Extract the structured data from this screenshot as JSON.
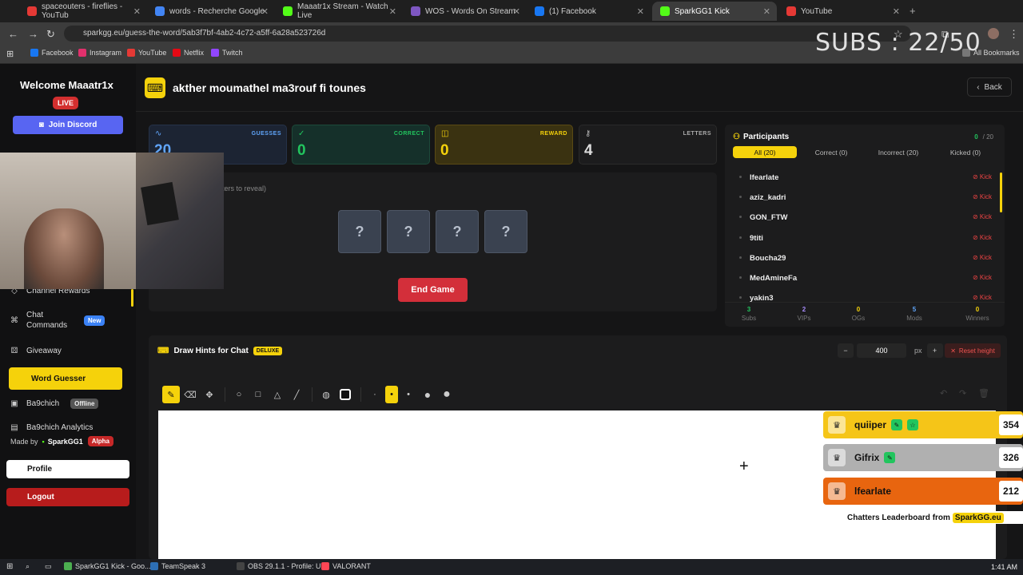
{
  "browser": {
    "tabs": [
      {
        "title": "spaceouters - fireflies - YouTub",
        "color": "#e53935"
      },
      {
        "title": "words - Recherche Google",
        "color": "#4285f4"
      },
      {
        "title": "Maaatr1x Stream - Watch Live",
        "color": "#53fc18"
      },
      {
        "title": "WOS - Words On Stream",
        "color": "#7e57c2"
      },
      {
        "title": "(1) Facebook",
        "color": "#1877f2"
      },
      {
        "title": "SparkGG1 Kick",
        "color": "#53fc18"
      },
      {
        "title": "YouTube",
        "color": "#e53935"
      }
    ],
    "url": "sparkgg.eu/guess-the-word/5ab3f7bf-4ab2-4c72-a5ff-6a28a523726d",
    "bookmarks": [
      {
        "label": "Facebook",
        "color": "#1877f2"
      },
      {
        "label": "Instagram",
        "color": "#e1306c"
      },
      {
        "label": "YouTube",
        "color": "#e53935"
      },
      {
        "label": "Netflix",
        "color": "#e50914"
      },
      {
        "label": "Twitch",
        "color": "#9146ff"
      }
    ],
    "all_bookmarks": "All Bookmarks",
    "overlay_subs": "SUBS : 22/50"
  },
  "sidebar": {
    "welcome": "Welcome",
    "username": "Maaatr1x",
    "live": "LIVE",
    "join_discord": "Join Discord",
    "items": {
      "channel_rewards": "Channel Rewards",
      "chat_commands": "Chat Commands",
      "chat_commands_badge": "New",
      "giveaway": "Giveaway",
      "word_guesser": "Word Guesser",
      "ba9chich": "Ba9chich",
      "ba9chich_badge": "Offline",
      "ba9chich_analytics": "Ba9chich Analytics"
    },
    "made_by": "Made by",
    "made_by_brand": "SparkGG1",
    "alpha": "Alpha",
    "profile": "Profile",
    "logout": "Logout"
  },
  "header": {
    "title": "akther moumathel ma3rouf fi tounes",
    "back": "Back"
  },
  "stats": {
    "guesses_label": "GUESSES",
    "guesses": "20",
    "correct_label": "CORRECT",
    "correct": "0",
    "reward_label": "REWARD",
    "reward": "0",
    "letters_label": "LETTERS",
    "letters": "4"
  },
  "game": {
    "hint": "ters to reveal)",
    "letters": [
      "?",
      "?",
      "?",
      "?"
    ],
    "end_game": "End Game"
  },
  "participants": {
    "title": "Participants",
    "correct_count": "0",
    "total": "20",
    "tabs": [
      "All (20)",
      "Correct (0)",
      "Incorrect (20)",
      "Kicked (0)"
    ],
    "kick": "Kick",
    "list": [
      "lfearlate",
      "aziz_kadri",
      "GON_FTW",
      "9titi",
      "Boucha29",
      "MedAmineFa",
      "yakin3"
    ],
    "stats": [
      {
        "value": "3",
        "label": "Subs",
        "color": "#22c55e"
      },
      {
        "value": "2",
        "label": "VIPs",
        "color": "#a78bfa"
      },
      {
        "value": "0",
        "label": "OGs",
        "color": "#f5d20b"
      },
      {
        "value": "5",
        "label": "Mods",
        "color": "#60a5fa"
      },
      {
        "value": "0",
        "label": "Winners",
        "color": "#f5d20b"
      }
    ]
  },
  "draw": {
    "title": "Draw Hints for Chat",
    "badge": "DELUXE",
    "height": "400",
    "unit": "px",
    "reset": "Reset height"
  },
  "leaderboard": {
    "rows": [
      {
        "name": "quiiper",
        "score": "354",
        "color": "#f5c518"
      },
      {
        "name": "Gifrix",
        "score": "326",
        "color": "#b0b0b0"
      },
      {
        "name": "lfearlate",
        "score": "212",
        "color": "#e8650f"
      }
    ],
    "footer": "Chatters Leaderboard from",
    "footer_brand": "SparkGG.eu"
  },
  "taskbar": {
    "items": [
      "SparkGG1 Kick - Goo...",
      "TeamSpeak 3",
      "OBS 29.1.1 - Profile: U...",
      "VALORANT"
    ],
    "clock": "1:41 AM"
  }
}
